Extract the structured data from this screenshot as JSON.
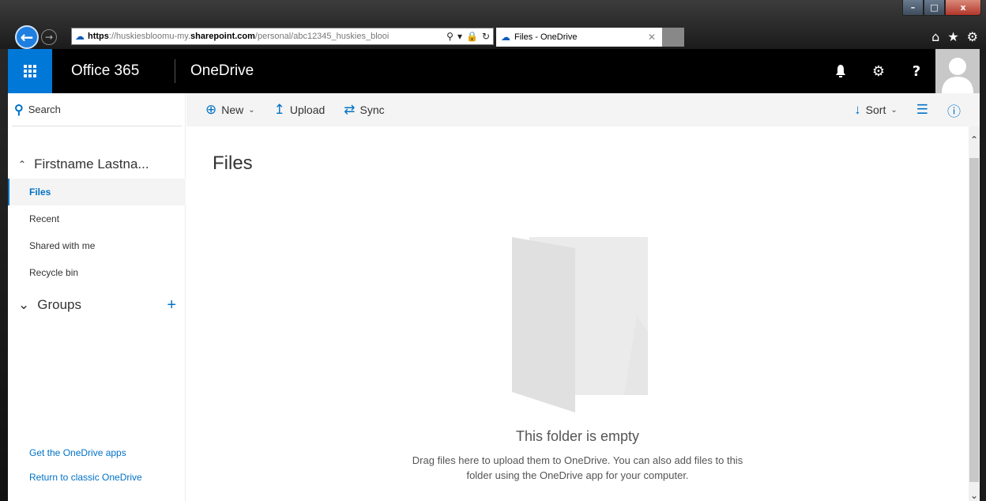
{
  "browser": {
    "url_scheme": "https",
    "url_pre_host": "://huskiesbloomu-my.",
    "url_host": "sharepoint.com",
    "url_path": "/personal/abc12345_huskies_blooi",
    "tab_title": "Files - OneDrive",
    "window_buttons": {
      "min": "–",
      "max": "□",
      "close": "x"
    }
  },
  "suite": {
    "brand": "Office 365",
    "app": "OneDrive"
  },
  "nav": {
    "search_label": "Search",
    "user_name": "Firstname Lastna...",
    "items": [
      {
        "label": "Files",
        "active": true
      },
      {
        "label": "Recent",
        "active": false
      },
      {
        "label": "Shared with me",
        "active": false
      },
      {
        "label": "Recycle bin",
        "active": false
      }
    ],
    "groups_label": "Groups",
    "links": [
      {
        "label": "Get the OneDrive apps"
      },
      {
        "label": "Return to classic OneDrive"
      }
    ]
  },
  "commands": {
    "new_label": "New",
    "upload_label": "Upload",
    "sync_label": "Sync",
    "sort_label": "Sort"
  },
  "main": {
    "title": "Files",
    "empty_title": "This folder is empty",
    "empty_desc": "Drag files here to upload them to OneDrive. You can also add files to this folder using the OneDrive app for your computer."
  },
  "colors": {
    "accent": "#0072c6",
    "waffle_bg": "#0078d7",
    "suite_bg": "#000000",
    "cmdbar_bg": "#f4f4f4"
  }
}
